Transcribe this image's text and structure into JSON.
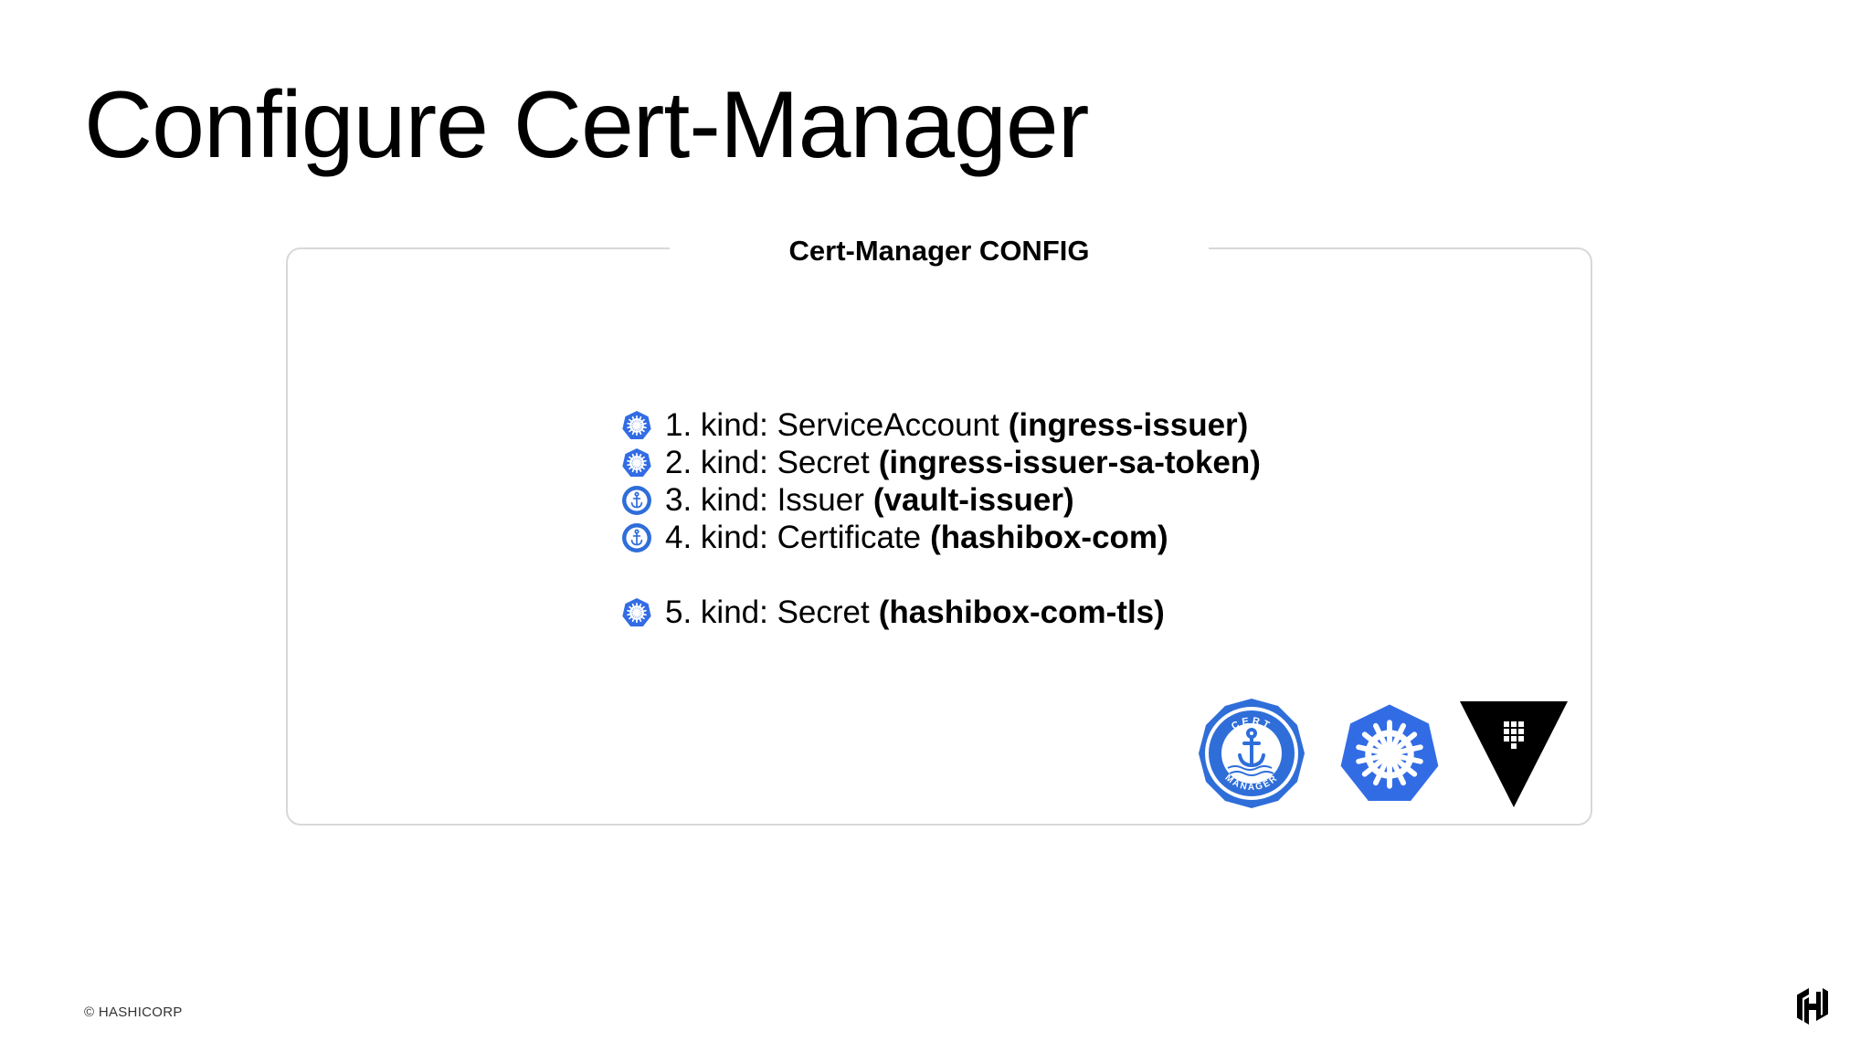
{
  "slide": {
    "title": "Configure Cert-Manager"
  },
  "panel": {
    "title": "Cert-Manager CONFIG",
    "items": [
      {
        "kind": "1. kind: ServiceAccount",
        "name": "(ingress-issuer)",
        "icon": "kubernetes-icon"
      },
      {
        "kind": "2. kind: Secret",
        "name": "(ingress-issuer-sa-token)",
        "icon": "kubernetes-icon"
      },
      {
        "kind": "3. kind: Issuer",
        "name": "(vault-issuer)",
        "icon": "cert-manager-icon"
      },
      {
        "kind": "4. kind: Certificate",
        "name": "(hashibox-com)",
        "icon": "cert-manager-icon"
      },
      {
        "kind": "5. kind: Secret",
        "name": "(hashibox-com-tls)",
        "icon": "kubernetes-icon"
      }
    ],
    "logos": {
      "cert_manager": {
        "icon": "cert-manager-logo",
        "text_top": "CERT",
        "text_bottom": "MANAGER"
      },
      "kubernetes": {
        "icon": "kubernetes-logo"
      },
      "vault": {
        "icon": "vault-logo"
      }
    }
  },
  "footer": {
    "copyright": "© HASHICORP",
    "logo": "hashicorp-logo"
  },
  "colors": {
    "kubernetes_blue": "#326ce5",
    "cert_manager_blue": "#2f6ed9",
    "vault_black": "#000000",
    "panel_border": "#d8d8d8"
  }
}
